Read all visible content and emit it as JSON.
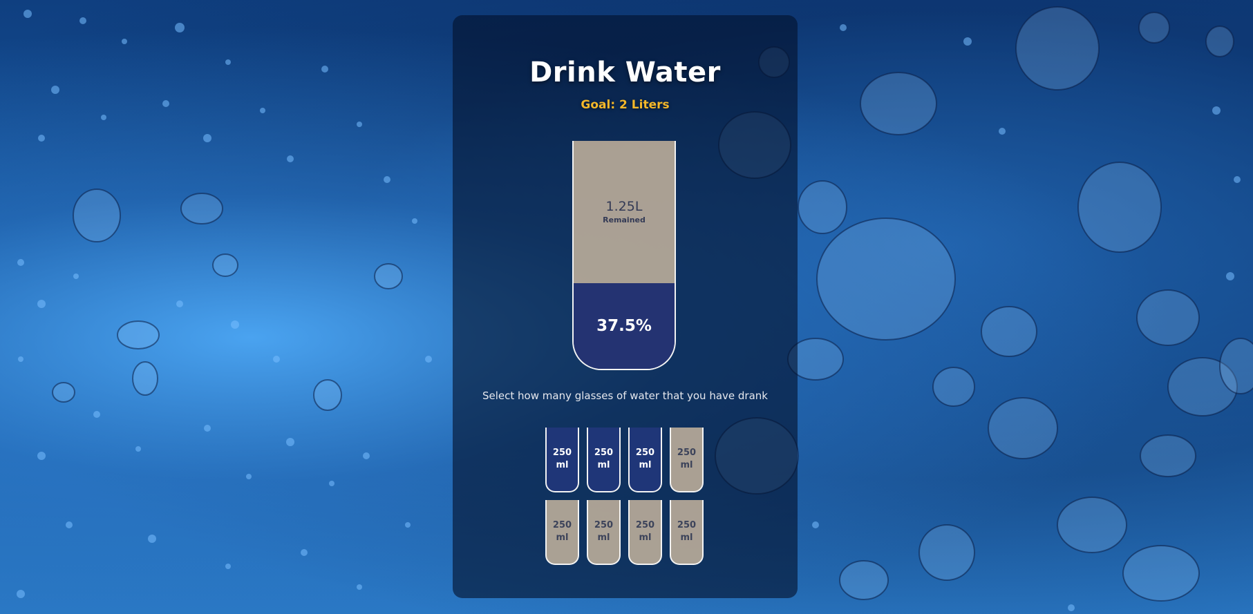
{
  "app": {
    "title": "Drink Water",
    "goal": "Goal: 2 Liters"
  },
  "tracker": {
    "remained_amount": "1.25L",
    "remained_label": "Remained",
    "percentage": "37.5%",
    "filled_fraction": 0.375
  },
  "instruction": "Select how many glasses of water that you have drank",
  "cups": [
    {
      "amount": "250",
      "unit": "ml",
      "filled": true
    },
    {
      "amount": "250",
      "unit": "ml",
      "filled": true
    },
    {
      "amount": "250",
      "unit": "ml",
      "filled": true
    },
    {
      "amount": "250",
      "unit": "ml",
      "filled": false
    },
    {
      "amount": "250",
      "unit": "ml",
      "filled": false
    },
    {
      "amount": "250",
      "unit": "ml",
      "filled": false
    },
    {
      "amount": "250",
      "unit": "ml",
      "filled": false
    },
    {
      "amount": "250",
      "unit": "ml",
      "filled": false
    }
  ],
  "colors": {
    "accent": "#f5b82a",
    "water": "#243372",
    "empty": "#cdb9a0",
    "background": "#16579f"
  }
}
